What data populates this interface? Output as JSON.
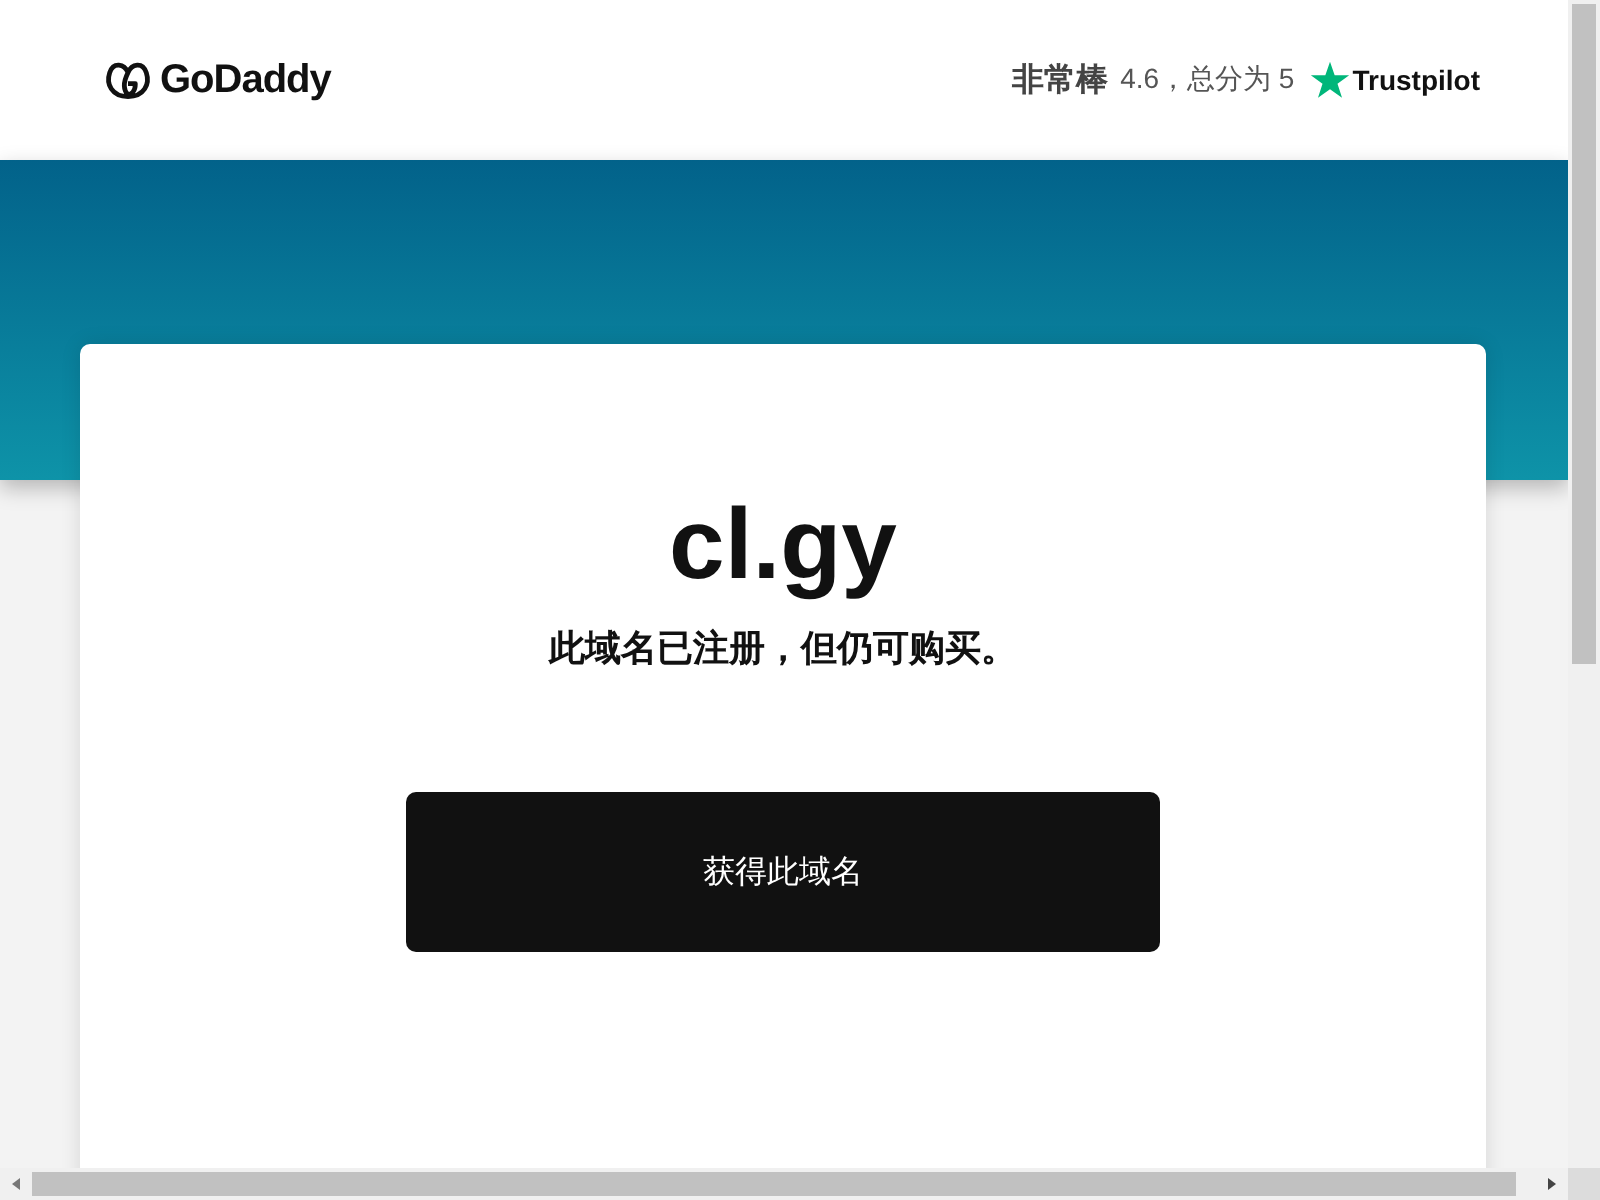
{
  "header": {
    "logo": "GoDaddy",
    "rating_label": "非常棒",
    "rating_text": "4.6，总分为 5",
    "review_site": "Trustpilot"
  },
  "card": {
    "domain": "cl.gy",
    "subtitle": "此域名已注册，但仍可购买。",
    "button": "获得此域名"
  }
}
